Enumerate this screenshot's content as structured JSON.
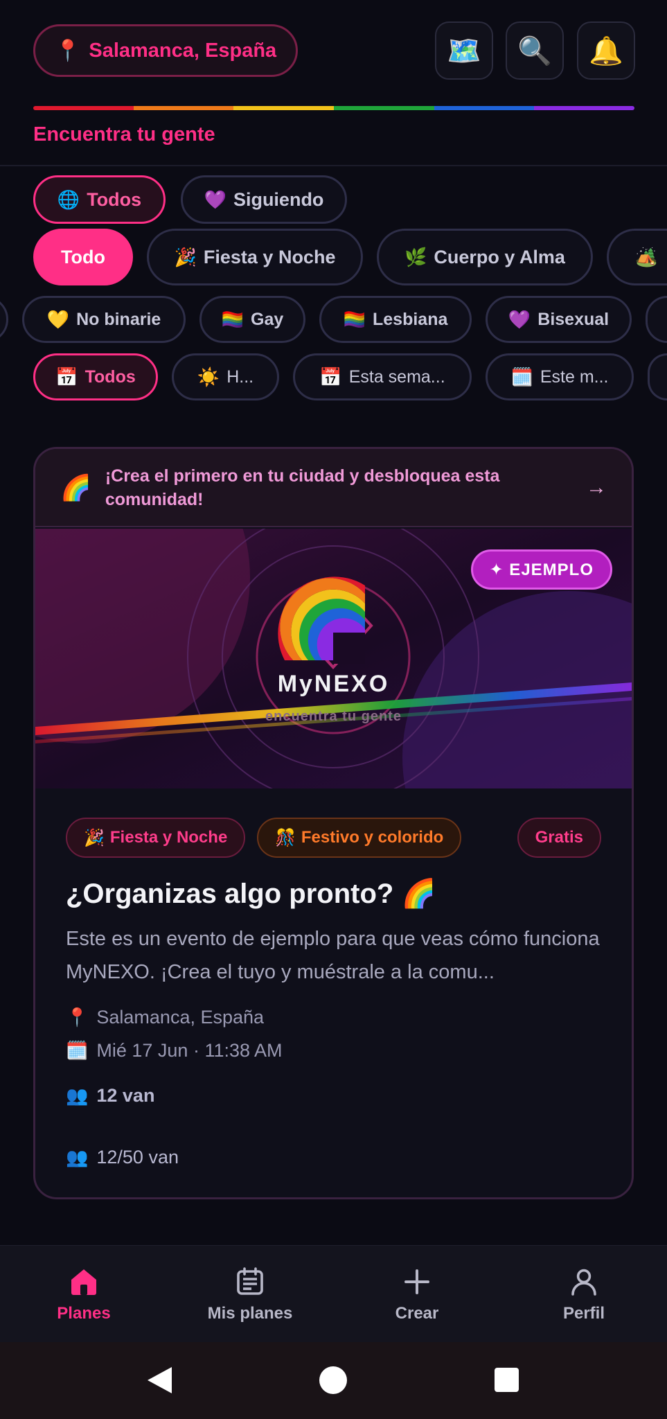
{
  "header": {
    "location": "Salamanca, España",
    "tagline": "Encuentra tu gente",
    "icons": [
      "map-icon",
      "search-icon",
      "bell-icon"
    ],
    "rainbow": [
      "#e0192e",
      "#f07a1a",
      "#f2c21b",
      "#1fa53a",
      "#1f63d8",
      "#8a2be2"
    ]
  },
  "scope_tabs": [
    {
      "emoji": "🌐",
      "label": "Todos"
    },
    {
      "emoji": "💜",
      "label": "Siguiendo"
    }
  ],
  "categories": [
    {
      "emoji": "",
      "label": "Todo"
    },
    {
      "emoji": "🎉",
      "label": "Fiesta y Noche"
    },
    {
      "emoji": "🌿",
      "label": "Cuerpo y Alma"
    },
    {
      "emoji": "🏕️",
      "label": ""
    }
  ],
  "identities": [
    {
      "emoji": "💛",
      "label": "No binarie"
    },
    {
      "emoji": "🏳️‍🌈",
      "label": "Gay"
    },
    {
      "emoji": "🏳️‍🌈",
      "label": "Lesbiana"
    },
    {
      "emoji": "💜",
      "label": "Bisexual"
    }
  ],
  "date_filters": [
    {
      "emoji": "📅",
      "label": "Todos"
    },
    {
      "emoji": "☀️",
      "label": "H..."
    },
    {
      "emoji": "📅",
      "label": "Esta sema..."
    },
    {
      "emoji": "🗓️",
      "label": "Este m..."
    }
  ],
  "card": {
    "create_banner": "¡Crea el primero en tu ciudad y desbloquea esta comunidad!",
    "create_arrow": "→",
    "badge": "✦ EJEMPLO",
    "hero_title": "MyNEXO",
    "hero_sub": "encuentra tu gente",
    "tags": [
      {
        "emoji": "🎉",
        "label": "Fiesta y Noche"
      },
      {
        "emoji": "🎊",
        "label": "Festivo y colorido"
      }
    ],
    "price": "Gratis",
    "title": "¿Organizas algo pronto? 🌈",
    "description": "Este es un evento de ejemplo para que veas cómo funciona MyNEXO. ¡Crea el tuyo y muéstrale a la comu...",
    "location": "Salamanca, España",
    "datetime": "Mié 17 Jun · 11:38 AM",
    "going": "12 van",
    "capacity": "12/50 van"
  },
  "bottom_nav": [
    {
      "label": "Planes",
      "icon": "home-icon",
      "active": true
    },
    {
      "label": "Mis planes",
      "icon": "calendar-list-icon",
      "active": false
    },
    {
      "label": "Crear",
      "icon": "plus-icon",
      "active": false
    },
    {
      "label": "Perfil",
      "icon": "person-icon",
      "active": false
    }
  ],
  "colors": {
    "accent": "#ff2f86",
    "background": "#0b0b14"
  }
}
